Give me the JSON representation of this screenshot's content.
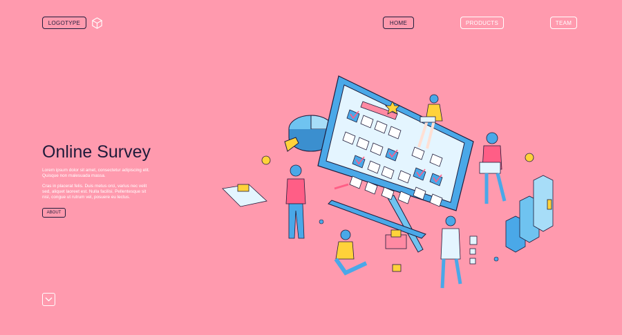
{
  "nav": {
    "logo_label": "LOGOTYPE",
    "home_label": "HOME",
    "products_label": "PRODUCTS",
    "team_label": "TEAM"
  },
  "hero": {
    "title": "Online Survey",
    "paragraph_1": "Lorem ipsum dolor sit amet, consectetur adipiscing elit. Quisque non malesuada massa.",
    "paragraph_2": "Cras in placerat felis. Duis metus orci, varius nec velit sed, aliquet laoreet est. Nulla facilisi. Pellentesque sit nisl, congue ut rutrum vel, posuere eu lectus.",
    "about_label": "ABOUT"
  },
  "colors": {
    "background": "#ff9aae",
    "dark": "#1e1b3a",
    "accent_blue": "#4aa8e8",
    "accent_yellow": "#ffd23a"
  },
  "icons": [
    "cube-icon",
    "chevron-down-icon"
  ]
}
